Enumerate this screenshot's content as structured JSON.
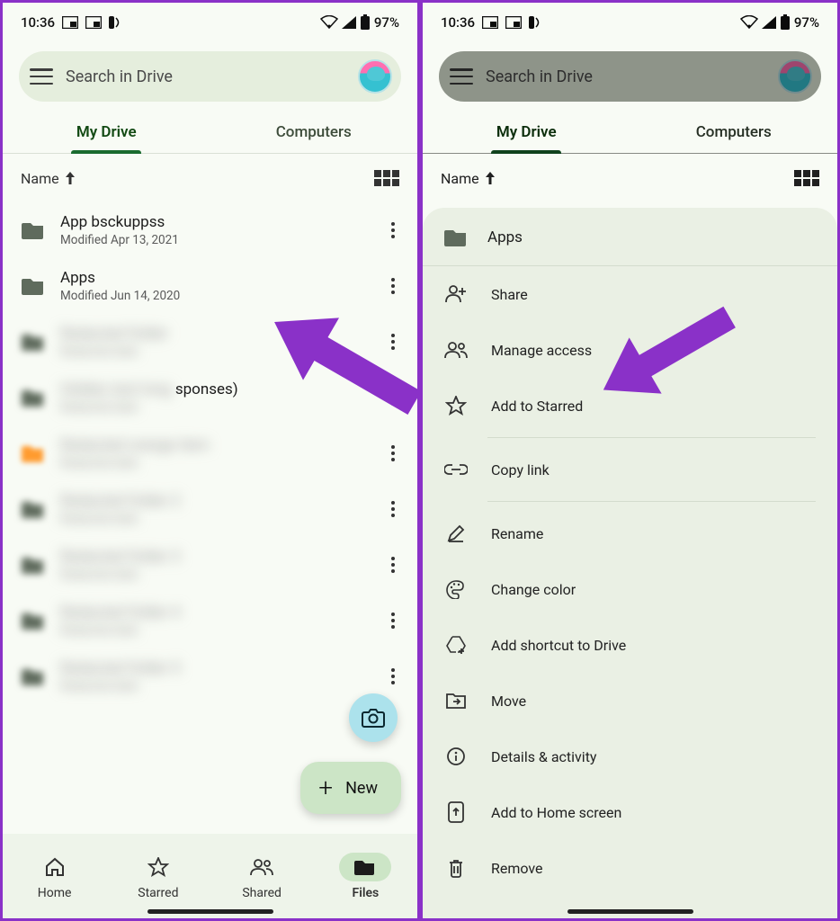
{
  "status": {
    "time": "10:36",
    "battery_pct": "97%"
  },
  "search": {
    "placeholder": "Search in Drive"
  },
  "tabs": {
    "my_drive": "My Drive",
    "computers": "Computers"
  },
  "sort": {
    "label": "Name"
  },
  "files": [
    {
      "name": "App bsckuppss",
      "modified": "Modified Apr 13, 2021",
      "blurred": false
    },
    {
      "name": "Apps",
      "modified": "Modified Jun 14, 2020",
      "blurred": false
    },
    {
      "name": "Redacted folder",
      "modified": "Redacted date",
      "blurred": true
    },
    {
      "name": "Redacted item (Responses)",
      "modified": "Redacted date",
      "blurred": true,
      "suffix": "sponses)"
    },
    {
      "name": "Redacted orange item",
      "modified": "Redacted date",
      "blurred": true,
      "orange": true
    },
    {
      "name": "Redacted folder 2",
      "modified": "Redacted date",
      "blurred": true
    },
    {
      "name": "Redacted folder 3",
      "modified": "Redacted date",
      "blurred": true
    },
    {
      "name": "Redacted folder 4",
      "modified": "Redacted date",
      "blurred": true
    },
    {
      "name": "Redacted folder 5",
      "modified": "Redacted date",
      "blurred": true
    }
  ],
  "fab": {
    "new": "New"
  },
  "nav": {
    "home": "Home",
    "starred": "Starred",
    "shared": "Shared",
    "files": "Files"
  },
  "sheet": {
    "title": "Apps",
    "items": [
      {
        "icon": "person-add",
        "label": "Share"
      },
      {
        "icon": "group",
        "label": "Manage access"
      },
      {
        "icon": "star",
        "label": "Add to Starred"
      },
      {
        "sep": true
      },
      {
        "icon": "link",
        "label": "Copy link"
      },
      {
        "sep": true
      },
      {
        "icon": "pencil",
        "label": "Rename"
      },
      {
        "icon": "palette",
        "label": "Change color"
      },
      {
        "icon": "drive-add",
        "label": "Add shortcut to Drive"
      },
      {
        "icon": "move",
        "label": "Move"
      },
      {
        "icon": "info",
        "label": "Details & activity"
      },
      {
        "icon": "add-home",
        "label": "Add to Home screen"
      },
      {
        "icon": "trash",
        "label": "Remove"
      }
    ]
  }
}
